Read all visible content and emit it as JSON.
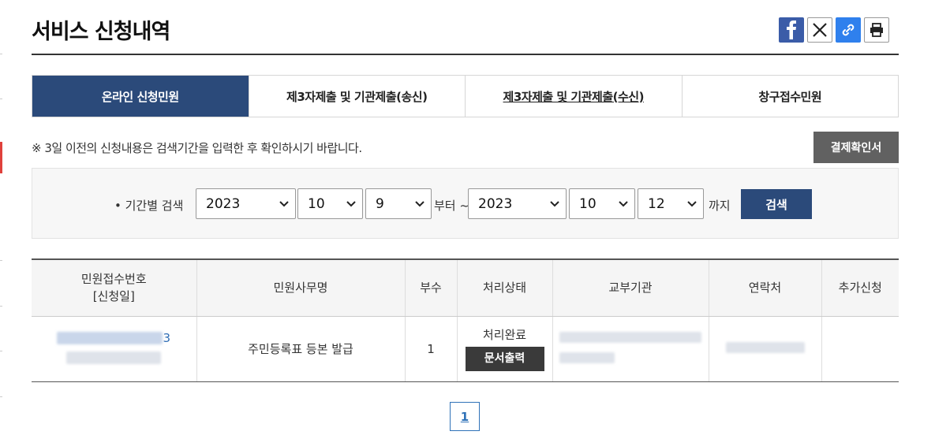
{
  "page": {
    "title": "서비스 신청내역"
  },
  "share": {
    "icons": [
      "facebook-icon",
      "x-icon",
      "link-icon",
      "print-icon"
    ]
  },
  "tabs": [
    {
      "label": "온라인 신청민원",
      "active": true
    },
    {
      "label": "제3자제출 및 기관제출(송신)",
      "active": false
    },
    {
      "label": "제3자제출 및 기관제출(수신)",
      "active": false
    },
    {
      "label": "창구접수민원",
      "active": false
    }
  ],
  "notice": "※ 3일 이전의 신청내용은 검색기간을 입력한 후 확인하시기 바랍니다.",
  "receipt_button": "결제확인서",
  "search": {
    "label": "• 기간별 검색",
    "from": {
      "year": "2023",
      "month": "10",
      "day": "9"
    },
    "from_suffix": "부터 ~",
    "to": {
      "year": "2023",
      "month": "10",
      "day": "12"
    },
    "to_suffix": "까지",
    "button": "검색"
  },
  "table": {
    "headers": {
      "receipt_no": "민원접수번호",
      "receipt_no_sub": "[신청일]",
      "service_name": "민원사무명",
      "copies": "부수",
      "status": "처리상태",
      "issuer": "교부기관",
      "contact": "연락처",
      "extra": "추가신청"
    },
    "rows": [
      {
        "receipt_suffix": "3",
        "service_name": "주민등록표 등본 발급",
        "copies": "1",
        "status": "처리완료",
        "print_button": "문서출력"
      }
    ]
  },
  "pagination": {
    "current": "1"
  },
  "colors": {
    "primary": "#2b4a7a",
    "dark_button": "#616161"
  }
}
